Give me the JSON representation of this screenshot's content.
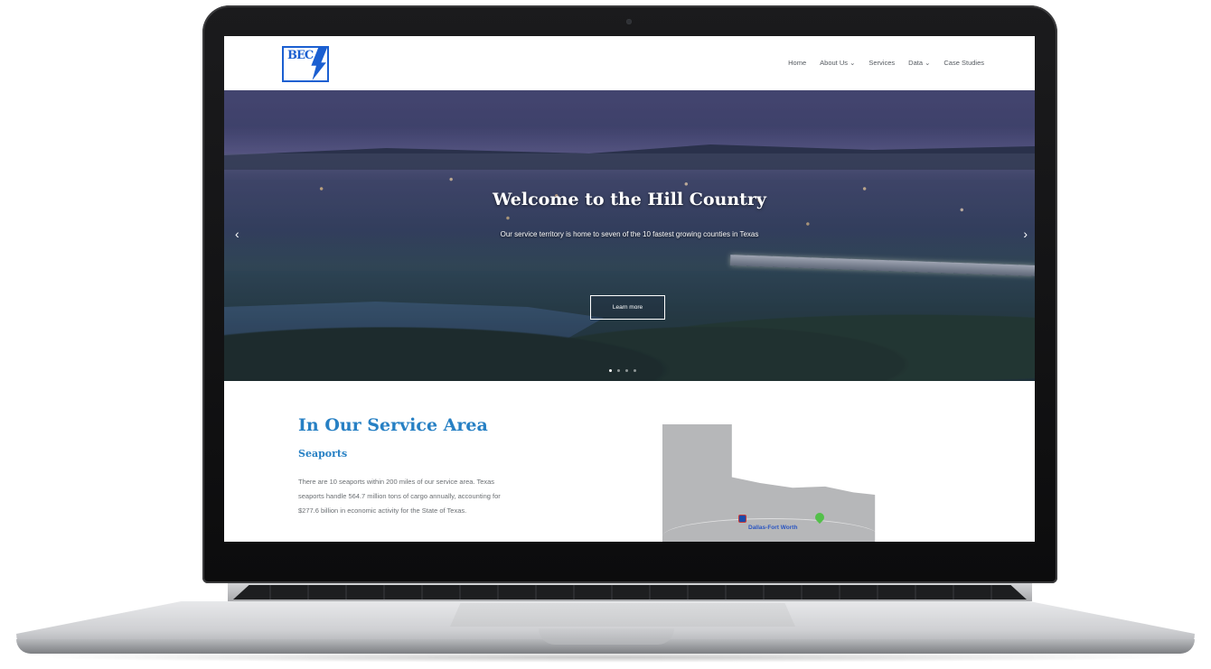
{
  "site": {
    "logo_text": "BEC"
  },
  "nav": {
    "items": [
      {
        "label": "Home"
      },
      {
        "label": "About Us"
      },
      {
        "label": "Services"
      },
      {
        "label": "Data"
      },
      {
        "label": "Case Studies"
      }
    ],
    "dropdown_icon": "chevron-down-icon"
  },
  "hero": {
    "title": "Welcome to the Hill Country",
    "subtitle": "Our service territory is home to seven of the 10 fastest growing counties in Texas",
    "button_label": "Learn more",
    "prev_icon": "chevron-left-icon",
    "next_icon": "chevron-right-icon",
    "slide_count": 4,
    "active_slide": 1
  },
  "section": {
    "title": "In Our Service Area",
    "subtitle": "Seaports",
    "body": "There are 10 seaports within 200 miles of our service area. Texas seaports handle 564.7 million tons of cargo annually, accounting for $277.6 billion in economic activity for the State of Texas."
  },
  "map": {
    "label": "Dallas-Fort Worth"
  },
  "colors": {
    "brand_blue": "#1b5fd1",
    "heading_blue": "#2780c4",
    "nav_text": "#555a60"
  }
}
